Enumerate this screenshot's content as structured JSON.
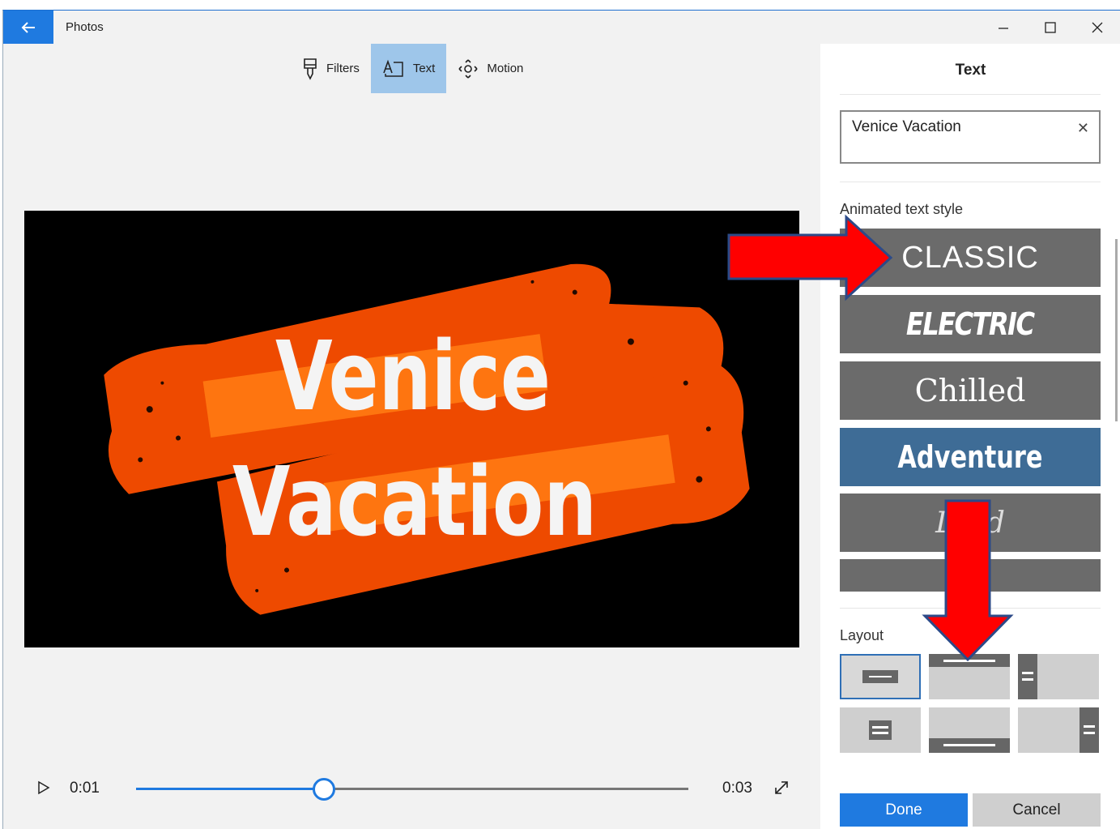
{
  "window": {
    "title": "Photos"
  },
  "toolbar": {
    "filters": "Filters",
    "text": "Text",
    "motion": "Motion"
  },
  "preview": {
    "line1": "Venice",
    "line2": "Vacation"
  },
  "playback": {
    "current_time": "0:01",
    "total_time": "0:03",
    "progress": 0.34
  },
  "panel": {
    "title": "Text",
    "input_value": "Venice Vacation",
    "styles_label": "Animated text style",
    "styles": [
      {
        "label": "CLASSIC"
      },
      {
        "label": "ELECTRIC"
      },
      {
        "label": "Chilled"
      },
      {
        "label": "Adventure",
        "selected": true
      },
      {
        "label": "Lord"
      },
      {
        "label": ""
      }
    ],
    "layout_label": "Layout",
    "done": "Done",
    "cancel": "Cancel"
  },
  "colors": {
    "accent": "#1f7ae0",
    "selected_style": "#3e6c96",
    "text_bg": "#ee4a00",
    "arrow": "#ff0000"
  }
}
